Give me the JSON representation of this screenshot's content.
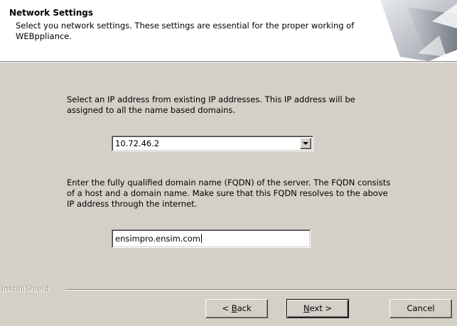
{
  "header": {
    "title": "Network Settings",
    "description": "Select you network settings. These settings are essential for the proper working of WEBppliance."
  },
  "ip_section": {
    "instruction": "Select an IP address from existing IP addresses. This IP address will be assigned to all the name based domains.",
    "selected_ip": "10.72.46.2"
  },
  "fqdn_section": {
    "instruction": "Enter the fully qualified domain name (FQDN) of the server. The FQDN consists of a host and a domain name. Make sure that this FQDN resolves to the above IP address through the internet.",
    "value": "ensimpro.ensim.com"
  },
  "footer": {
    "brand": "InstallShield"
  },
  "buttons": {
    "back_prefix": "< ",
    "back_mnemonic": "B",
    "back_rest": "ack",
    "next_mnemonic": "N",
    "next_rest": "ext >",
    "cancel": "Cancel"
  },
  "icons": {
    "header_graphic": "installshield-banner-graphic",
    "dropdown": "chevron-down-icon"
  }
}
